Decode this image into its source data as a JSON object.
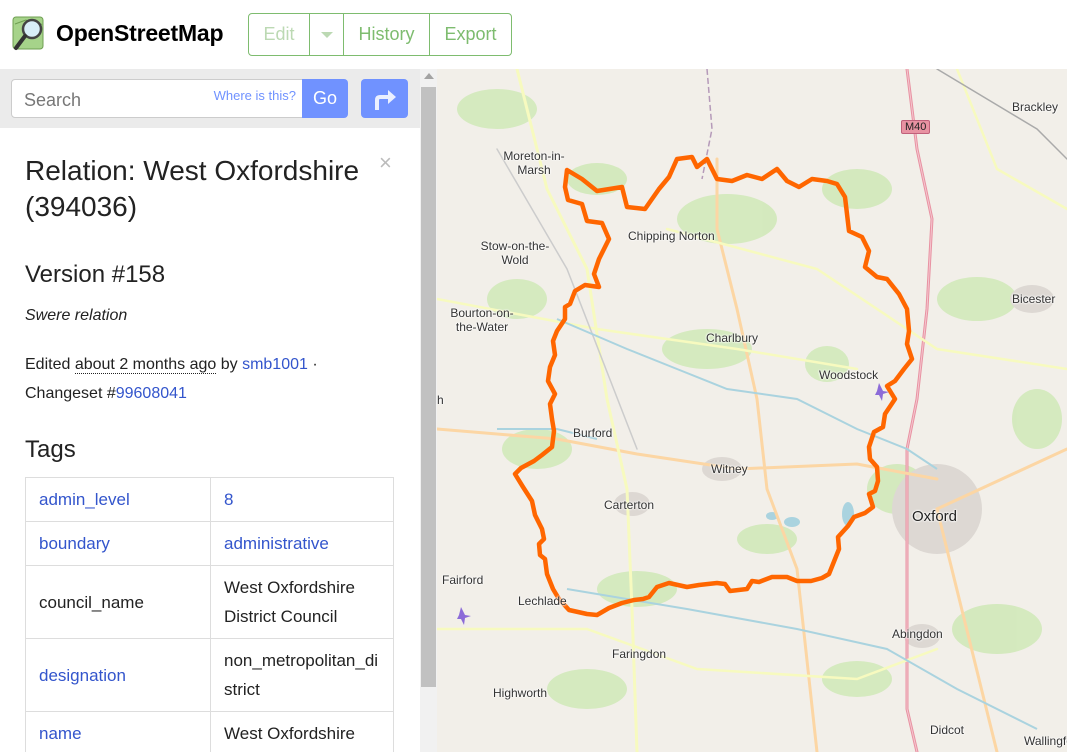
{
  "header": {
    "brand_name": "OpenStreetMap",
    "buttons": {
      "edit": "Edit",
      "history": "History",
      "export": "Export"
    }
  },
  "search": {
    "placeholder": "Search",
    "where_link": "Where is this?",
    "go_label": "Go"
  },
  "close_label": "×",
  "feature": {
    "title": "Relation: West Oxfordshire (394036)",
    "version": "Version #158",
    "comment": "Swere relation",
    "edited_prefix": "Edited",
    "edited_ago": "about 2 months ago",
    "edited_by": "by",
    "user": "smb1001",
    "dot": " ·",
    "changeset_prefix": "Changeset #",
    "changeset": "99608041"
  },
  "tags_heading": "Tags",
  "tags": [
    {
      "key": "admin_level",
      "value": "8"
    },
    {
      "key": "boundary",
      "value": "administrative"
    },
    {
      "key": "council_name",
      "value": "West Oxfordshire District Council"
    },
    {
      "key": "designation",
      "value": "non_metropolitan_district"
    },
    {
      "key": "name",
      "value": "West Oxfordshire"
    }
  ],
  "map": {
    "places": {
      "moreton": "Moreton-in-Marsh",
      "stow": "Stow-on-the-Wold",
      "bourton": "Bourton-on-the-Water",
      "chipping_norton": "Chipping Norton",
      "charlbury": "Charlbury",
      "woodstock": "Woodstock",
      "burford": "Burford",
      "witney": "Witney",
      "carterton": "Carterton",
      "oxford": "Oxford",
      "fairford": "Fairford",
      "lechlade": "Lechlade",
      "faringdon": "Faringdon",
      "highworth": "Highworth",
      "abingdon": "Abingdon",
      "didcot": "Didcot",
      "bicester": "Bicester",
      "brackley": "Brackley",
      "wallingford": "Wallingfo",
      "h": "h"
    },
    "motorway": "M40",
    "boundary_color": "#ff6600"
  }
}
